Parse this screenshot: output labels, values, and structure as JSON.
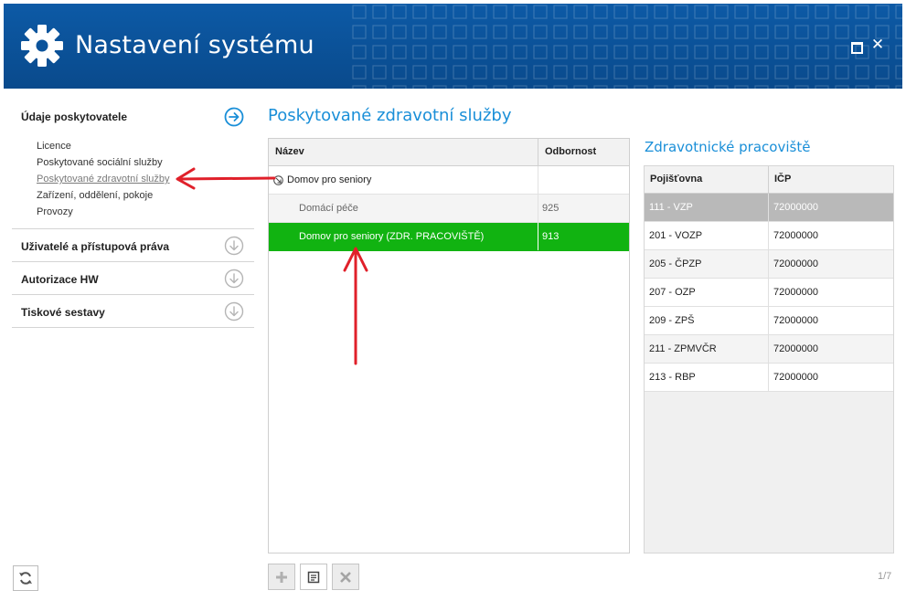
{
  "window": {
    "title": "Nastavení systému",
    "maximize_icon": "maximize-icon",
    "close_glyph": "✕"
  },
  "sidebar": {
    "sections": [
      {
        "title": "Údaje poskytovatele",
        "expanded": true,
        "items": [
          {
            "label": "Licence"
          },
          {
            "label": "Poskytované sociální služby"
          },
          {
            "label": "Poskytované zdravotní služby",
            "active": true
          },
          {
            "label": "Zařízení, oddělení, pokoje"
          },
          {
            "label": "Provozy"
          }
        ]
      },
      {
        "title": "Uživatelé a přístupová práva"
      },
      {
        "title": "Autorizace HW"
      },
      {
        "title": "Tiskové sestavy"
      }
    ]
  },
  "main": {
    "title": "Poskytované zdravotní služby",
    "grid": {
      "columns": [
        "Název",
        "Odbornost"
      ],
      "rows": [
        {
          "name": "Domov pro seniory",
          "odbornost": "",
          "type": "parent"
        },
        {
          "name": "Domácí péče",
          "odbornost": "925",
          "type": "child"
        },
        {
          "name": "Domov pro seniory (ZDR. PRACOVIŠTĚ)",
          "odbornost": "913",
          "type": "selected"
        }
      ]
    },
    "toolbar": {
      "add_icon": "plus-icon",
      "edit_icon": "edit-icon",
      "delete_icon": "delete-icon"
    }
  },
  "side_panel": {
    "title": "Zdravotnické pracoviště",
    "columns": [
      "Pojišťovna",
      "IČP"
    ],
    "rows": [
      {
        "pojistovna": "111 - VZP",
        "icp": "72000000"
      },
      {
        "pojistovna": "201 - VOZP",
        "icp": "72000000"
      },
      {
        "pojistovna": "205 - ČPZP",
        "icp": "72000000"
      },
      {
        "pojistovna": "207 - OZP",
        "icp": "72000000"
      },
      {
        "pojistovna": "209 - ZPŠ",
        "icp": "72000000"
      },
      {
        "pojistovna": "211 - ZPMVČR",
        "icp": "72000000"
      },
      {
        "pojistovna": "213 - RBP",
        "icp": "72000000"
      }
    ]
  },
  "footer": {
    "pager": "1/7",
    "refresh_icon": "refresh-icon"
  },
  "colors": {
    "header": "#0a4f95",
    "accent": "#1a8fd8",
    "selected_row": "#11b311",
    "annotation_arrow": "#e0202a"
  }
}
